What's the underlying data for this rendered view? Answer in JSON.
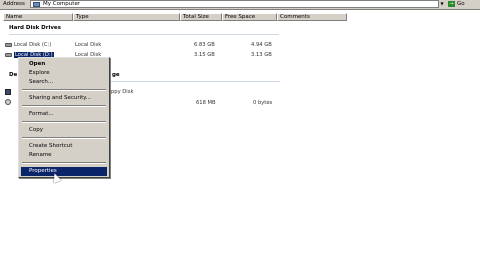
{
  "address_bar": {
    "label": "Address",
    "value": "My Computer",
    "go_label": "Go"
  },
  "columns": [
    "Name",
    "Type",
    "Total Size",
    "Free Space",
    "Comments"
  ],
  "sections": {
    "hard_disks": "Hard Disk Drives",
    "removable_partial": "ge"
  },
  "drives": [
    {
      "name": "Local Disk (C:)",
      "type": "Local Disk",
      "total": "6.83 GB",
      "free": "4.94 GB"
    },
    {
      "name": "Local Disk (D:)",
      "type": "Local Disk",
      "total": "3.15 GB",
      "free": "3.13 GB"
    },
    {
      "name": "",
      "type": "ppy Disk",
      "total": "",
      "free": ""
    },
    {
      "name": "",
      "type": "",
      "total": "618 MB",
      "free": "0 bytes"
    }
  ],
  "context_menu": {
    "items": [
      {
        "label": "Open",
        "bold": true
      },
      {
        "label": "Explore"
      },
      {
        "label": "Search..."
      },
      {
        "label": "Sharing and Security..."
      },
      {
        "label": "Format..."
      },
      {
        "label": "Copy"
      },
      {
        "label": "Create Shortcut"
      },
      {
        "label": "Rename"
      },
      {
        "label": "Properties",
        "highlighted": true
      }
    ]
  },
  "colors": {
    "selection": "#0a246a",
    "menu_bg": "#d4d0c8"
  }
}
